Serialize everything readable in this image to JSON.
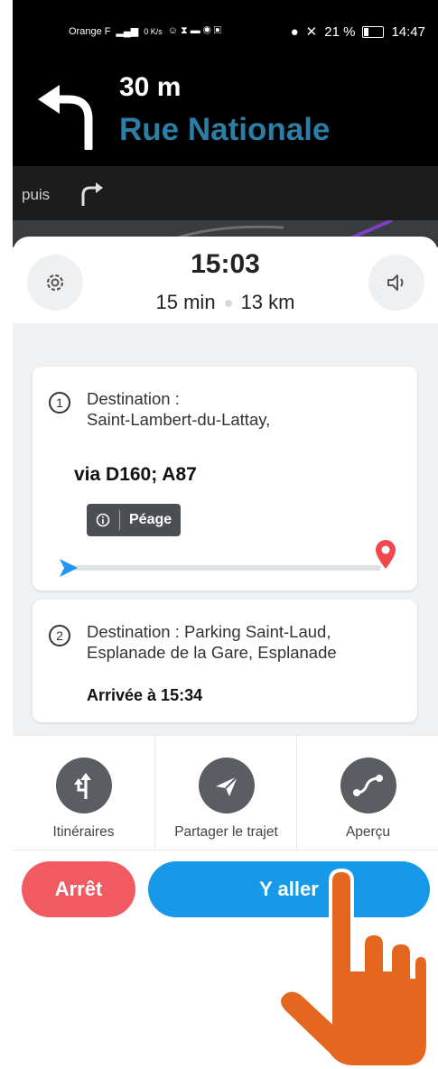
{
  "status_bar": {
    "carrier": "Orange F",
    "data_speed": "0 K/s",
    "battery_percent": "21 %",
    "time": "14:47"
  },
  "navigation": {
    "distance": "30 m",
    "street": "Rue Nationale",
    "then_label": "puis",
    "turn_icon": "turn-left-arrow",
    "then_icon": "turn-right-arrow"
  },
  "trip": {
    "arrival_time": "15:03",
    "duration": "15 min",
    "distance": "13 km"
  },
  "stops": [
    {
      "number": "1",
      "destination_line1": "Destination :",
      "destination_line2": "Saint-Lambert-du-Lattay,",
      "via": "via D160; A87",
      "badge": "Péage"
    },
    {
      "number": "2",
      "destination_line1": "Destination : Parking Saint-Laud,",
      "destination_line2": "Esplanade de la Gare, Esplanade",
      "arrival": "Arrivée à 15:34"
    }
  ],
  "actions": {
    "routes_label": "Itinéraires",
    "share_label": "Partager le trajet",
    "preview_label": "Aperçu"
  },
  "buttons": {
    "stop_label": "Arrêt",
    "go_label": "Y aller"
  },
  "colors": {
    "street": "#2d7ea7",
    "go_button": "#1799ea",
    "stop_button": "#f25a62",
    "destination_pin": "#f0484f",
    "start_pin": "#2196f3",
    "hand_overlay": "#e4661f"
  }
}
